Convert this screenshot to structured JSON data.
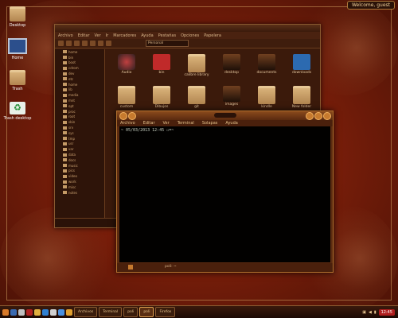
{
  "desktop": {
    "icons": [
      {
        "label": "Desktop",
        "kind": "folder"
      },
      {
        "label": "Home",
        "kind": "computer"
      },
      {
        "label": "Trash",
        "kind": "folder"
      },
      {
        "label": "Trash desktop",
        "kind": "recycle"
      }
    ],
    "welcome_label": "Welcome, guest"
  },
  "file_manager": {
    "menu": [
      "Archivo",
      "Editar",
      "Ver",
      "Ir",
      "Marcadores",
      "Ayuda",
      "Pestañas",
      "Opciones",
      "Papelera"
    ],
    "address": "Personal",
    "tree": [
      "home",
      "bin",
      "boot",
      "cdrom",
      "dev",
      "etc",
      "home",
      "lib",
      "media",
      "mnt",
      "opt",
      "proc",
      "root",
      "sbin",
      "srv",
      "sys",
      "tmp",
      "usr",
      "var",
      "data",
      "docs",
      "music",
      "pics",
      "video",
      "work",
      "misc",
      "notes"
    ],
    "files": [
      {
        "label": "Audio",
        "icon": "app-icon"
      },
      {
        "label": "bin",
        "icon": "app-icon-red"
      },
      {
        "label": "calibre library",
        "icon": "folder-icon"
      },
      {
        "label": "desktop",
        "icon": "app-icon-dark"
      },
      {
        "label": "documents",
        "icon": "app-icon-dark"
      },
      {
        "label": "downloads",
        "icon": "app-icon-blue"
      },
      {
        "label": "custom",
        "icon": "folder-icon"
      },
      {
        "label": "Dibujos",
        "icon": "folder-icon"
      },
      {
        "label": "git",
        "icon": "folder-icon"
      },
      {
        "label": "images",
        "icon": "app-icon-dark"
      },
      {
        "label": "kindle",
        "icon": "folder-icon"
      },
      {
        "label": "New folder",
        "icon": "folder-icon"
      },
      {
        "label": "src",
        "icon": "folder-icon"
      },
      {
        "label": "spotify",
        "icon": "folder-icon"
      },
      {
        "label": "Videos",
        "icon": "folder-icon"
      },
      {
        "label": "",
        "icon": "image-icon"
      }
    ],
    "status": ""
  },
  "terminal": {
    "title": "",
    "menu": [
      "Archivo",
      "Editar",
      "Ver",
      "Terminal",
      "Solapas",
      "Ayuda"
    ],
    "prompt": "~ 05/03/2013 12:45 ☐=~",
    "status": "poli: ~"
  },
  "taskbar": {
    "tasks": [
      {
        "label": "Archivos",
        "active": false
      },
      {
        "label": "Terminal",
        "active": false
      },
      {
        "label": "poli",
        "active": false
      },
      {
        "label": "poli",
        "active": true
      },
      {
        "label": "Firefox",
        "active": false
      }
    ],
    "clock": "12:45"
  },
  "colors": {
    "accent": "#c67a2e",
    "terminal_bg": "#020100",
    "wallpaper": "#7a1e0a"
  }
}
